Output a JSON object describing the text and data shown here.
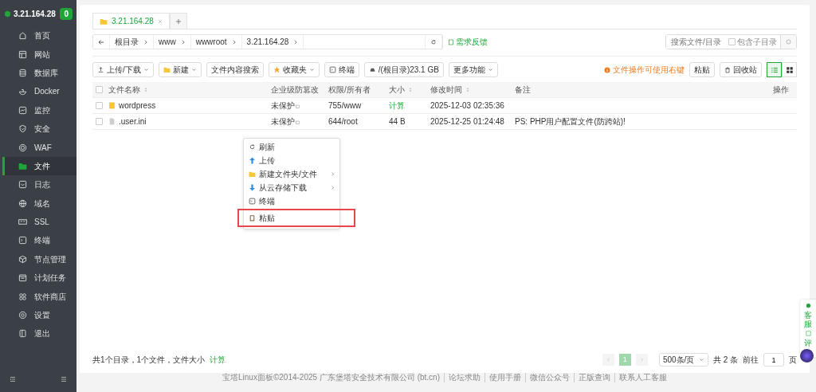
{
  "sidebar": {
    "server": "3.21.164.28",
    "badge": "0",
    "items": [
      {
        "label": "首页",
        "selected": false
      },
      {
        "label": "网站",
        "selected": false
      },
      {
        "label": "数据库",
        "selected": false
      },
      {
        "label": "Docker",
        "selected": false
      },
      {
        "label": "监控",
        "selected": false
      },
      {
        "label": "安全",
        "selected": false
      },
      {
        "label": "WAF",
        "selected": false
      },
      {
        "label": "文件",
        "selected": true
      },
      {
        "label": "日志",
        "selected": false
      },
      {
        "label": "域名",
        "selected": false
      },
      {
        "label": "SSL",
        "selected": false
      },
      {
        "label": "终端",
        "selected": false
      },
      {
        "label": "节点管理",
        "selected": false
      },
      {
        "label": "计划任务",
        "selected": false
      },
      {
        "label": "软件商店",
        "selected": false
      },
      {
        "label": "设置",
        "selected": false
      },
      {
        "label": "退出",
        "selected": false
      }
    ]
  },
  "tabs": [
    {
      "label": "3.21.164.28",
      "selected": true
    }
  ],
  "breadcrumb": [
    "根目录",
    "www",
    "wwwroot",
    "3.21.164.28"
  ],
  "feedback": "需求反馈",
  "search": {
    "placeholder": "搜索文件/目录",
    "subdir_label": "包含子目录",
    "subdir_checked": false
  },
  "toolbar": [
    {
      "label": "上传/下载",
      "dropdown": true
    },
    {
      "label": "新建",
      "dropdown": true
    },
    {
      "label": "文件内容搜索",
      "dropdown": false
    },
    {
      "label": "收藏夹",
      "dropdown": true
    },
    {
      "label": "终端",
      "dropdown": false
    },
    {
      "label": "/(根目录)23.1 GB",
      "dropdown": false
    },
    {
      "label": "更多功能",
      "dropdown": true
    }
  ],
  "hint": "文件操作可使用右键",
  "right_buttons": [
    "粘贴",
    "回收站"
  ],
  "view_modes": [
    {
      "selected": true
    },
    {
      "selected": false
    }
  ],
  "table": {
    "all_checked": false,
    "columns": [
      {
        "label": "文件名称",
        "sortable": true
      },
      {
        "label": "企业级防篡改",
        "sortable": false
      },
      {
        "label": "权限/所有者",
        "sortable": false
      },
      {
        "label": "大小",
        "sortable": true
      },
      {
        "label": "修改时间",
        "sortable": true
      },
      {
        "label": "备注",
        "sortable": false
      },
      {
        "label": "操作",
        "sortable": false
      }
    ],
    "rows": [
      {
        "kind": "folder",
        "checked": false,
        "name": "wordpress",
        "protect": "未保护",
        "perm": "755/www",
        "size": "计算",
        "size_link": true,
        "mtime": "2025-12-03 02:35:36",
        "note": ""
      },
      {
        "kind": "file",
        "checked": false,
        "name": ".user.ini",
        "protect": "未保护",
        "perm": "644/root",
        "size": "44 B",
        "size_link": false,
        "mtime": "2025-12-25 01:24:48",
        "note": "PS: PHP用户配置文件(防跨站)!"
      }
    ]
  },
  "context_menu": [
    {
      "label": "刷新",
      "submenu": false,
      "highlighted": false
    },
    {
      "label": "上传",
      "submenu": false,
      "highlighted": false
    },
    {
      "label": "新建文件夹/文件",
      "submenu": true,
      "highlighted": false
    },
    {
      "label": "从云存储下载",
      "submenu": true,
      "highlighted": false
    },
    {
      "label": "终端",
      "submenu": false,
      "highlighted": false
    },
    {
      "label": "粘贴",
      "submenu": false,
      "highlighted": true
    }
  ],
  "summary": {
    "text": "共1个目录，1个文件，文件大小",
    "link": "计算"
  },
  "pagination": {
    "pages": [
      {
        "label": "1",
        "selected": true
      }
    ],
    "page_size": "500条/页",
    "total": "共 2 条",
    "goto_label": "前往",
    "goto_value": "1",
    "page_unit": "页"
  },
  "footer": [
    "宝塔Linux面板©2014-2025 广东堡塔安全技术有限公司 (bt.cn)",
    "论坛求助",
    "使用手册",
    "微信公众号",
    "正版查询",
    "联系人工客服"
  ],
  "side_widget": [
    "客服",
    "评"
  ]
}
